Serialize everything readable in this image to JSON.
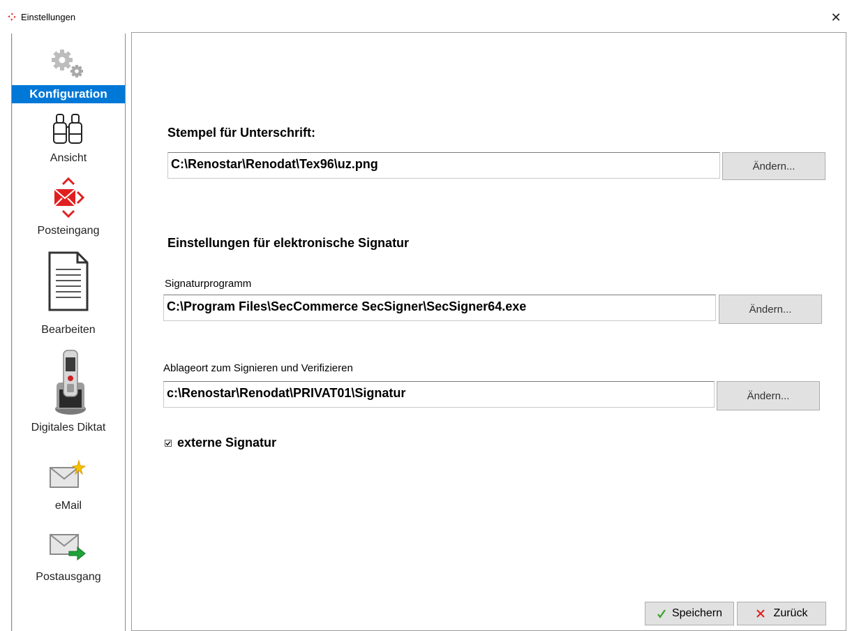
{
  "window": {
    "title": "Einstellungen",
    "close_glyph": "✕"
  },
  "sidebar": {
    "items": [
      {
        "label": "Konfiguration",
        "icon": "gears-icon",
        "active": true
      },
      {
        "label": "Ansicht",
        "icon": "binoculars-icon",
        "active": false
      },
      {
        "label": "Posteingang",
        "icon": "inbox-envelope-icon",
        "active": false
      },
      {
        "label": "Bearbeiten",
        "icon": "document-icon",
        "active": false
      },
      {
        "label": "Digitales Diktat",
        "icon": "dictation-device-icon",
        "active": false
      },
      {
        "label": "eMail",
        "icon": "new-mail-icon",
        "active": false
      },
      {
        "label": "Postausgang",
        "icon": "outbox-envelope-icon",
        "active": false
      }
    ]
  },
  "main": {
    "stamp": {
      "title": "Stempel für Unterschrift:",
      "path": "C:\\Renostar\\Renodat\\Tex96\\uz.png",
      "button": "Ändern..."
    },
    "signature_section_title": "Einstellungen für elektronische Signatur",
    "program": {
      "label": "Signaturprogramm",
      "path": "C:\\Program Files\\SecCommerce SecSigner\\SecSigner64.exe",
      "button": "Ändern..."
    },
    "storage": {
      "label": "Ablageort zum Signieren und Verifizieren",
      "path": "c:\\Renostar\\Renodat\\PRIVAT01\\Signatur",
      "button": "Ändern..."
    },
    "external_signature": {
      "label": "externe Signatur",
      "checked": true
    }
  },
  "footer": {
    "save_label": "Speichern",
    "back_label": "Zurück"
  },
  "colors": {
    "accent": "#0078d7",
    "button_bg": "#e1e1e1",
    "save_check": "#3aa12b",
    "back_x": "#e02020"
  }
}
